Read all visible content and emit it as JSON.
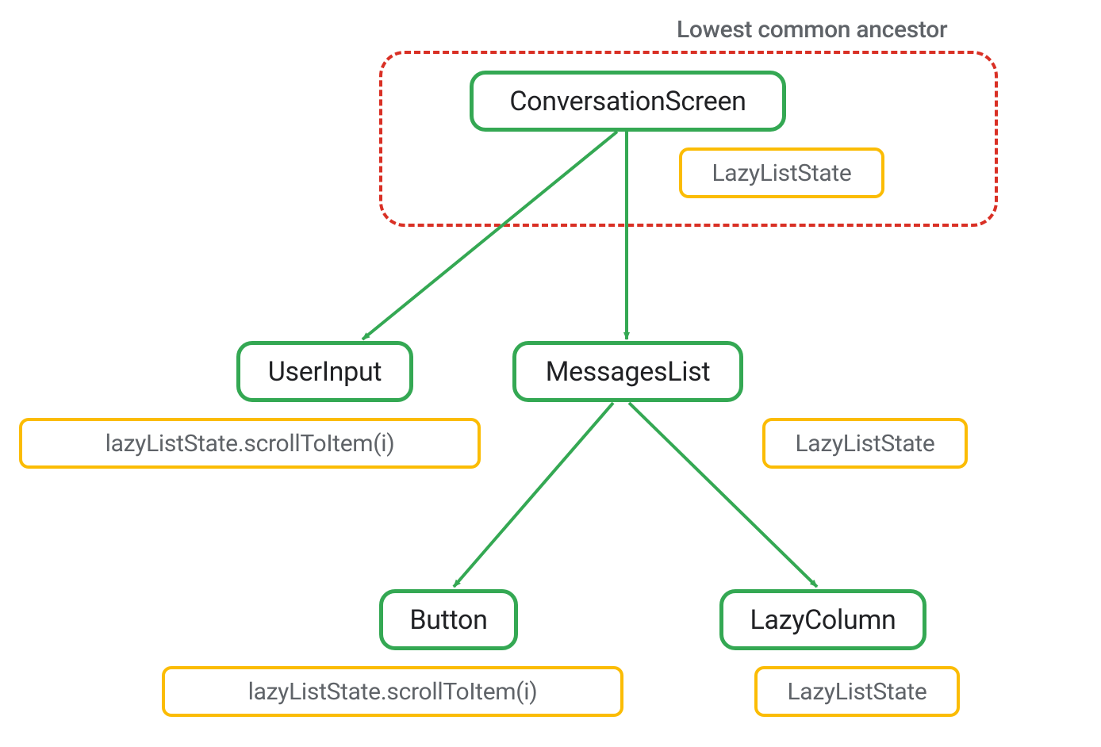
{
  "diagram": {
    "ancestor_label": "Lowest common ancestor",
    "nodes": {
      "conversation_screen": "ConversationScreen",
      "lazy_list_state_top": "LazyListState",
      "user_input": "UserInput",
      "user_input_annotation": "lazyListState.scrollToItem(i)",
      "messages_list": "MessagesList",
      "messages_list_annotation": "LazyListState",
      "button": "Button",
      "button_annotation": "lazyListState.scrollToItem(i)",
      "lazy_column": "LazyColumn",
      "lazy_column_annotation": "LazyListState"
    },
    "colors": {
      "green": "#34a853",
      "yellow": "#fbbc04",
      "red_dashed": "#d93025",
      "text_primary": "#202124",
      "text_secondary": "#5f6368"
    }
  }
}
